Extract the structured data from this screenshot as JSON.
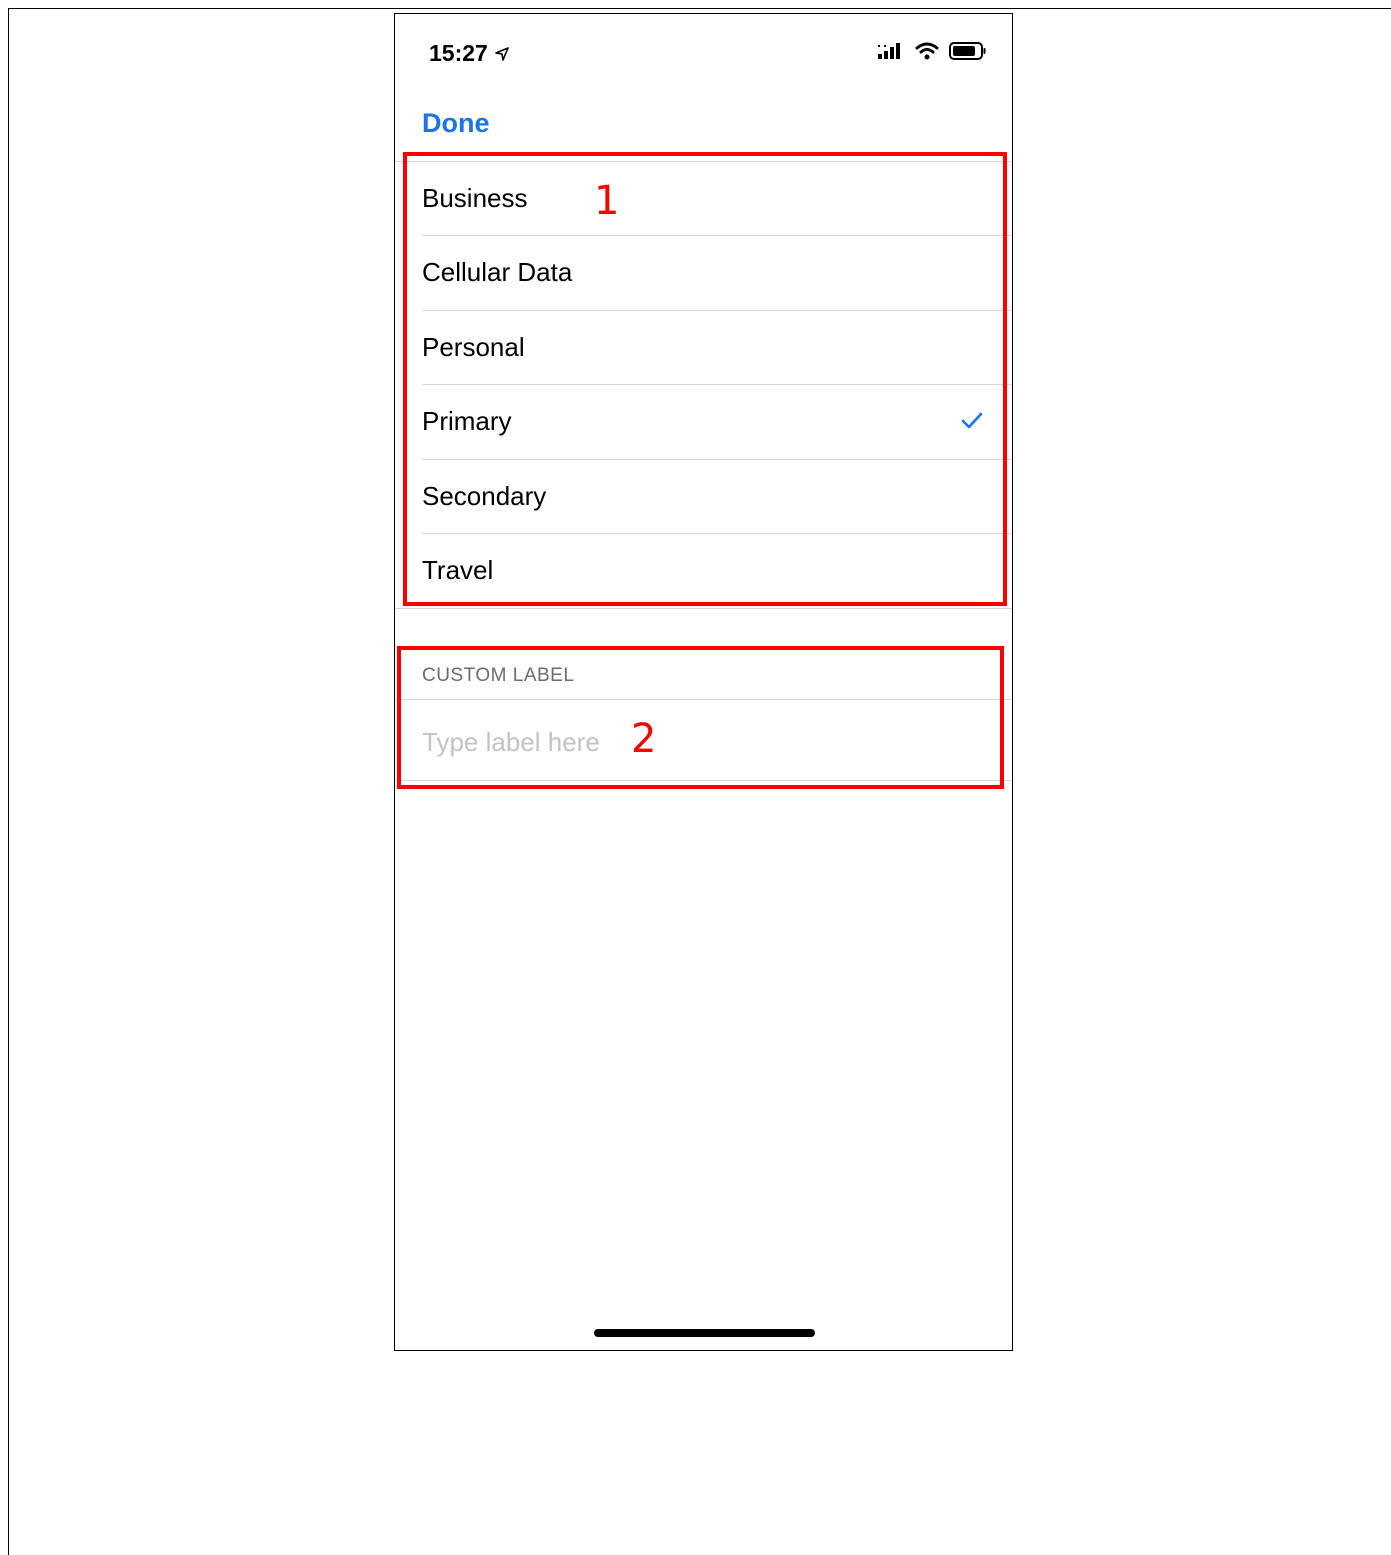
{
  "status_bar": {
    "time": "15:27",
    "location_icon": "location-arrow-icon",
    "signal_icon": "cellular-signal-icon",
    "wifi_icon": "wifi-icon",
    "battery_icon": "battery-icon"
  },
  "nav": {
    "done_label": "Done"
  },
  "labels": {
    "items": [
      {
        "label": "Business",
        "selected": false
      },
      {
        "label": "Cellular Data",
        "selected": false
      },
      {
        "label": "Personal",
        "selected": false
      },
      {
        "label": "Primary",
        "selected": true
      },
      {
        "label": "Secondary",
        "selected": false
      },
      {
        "label": "Travel",
        "selected": false
      }
    ],
    "check_icon": "checkmark-icon"
  },
  "custom_label": {
    "header": "CUSTOM LABEL",
    "placeholder": "Type label here",
    "value": ""
  },
  "annotations": {
    "box1_number": "1",
    "box2_number": "2",
    "color": "#ff0000"
  },
  "colors": {
    "accent": "#1a73e8",
    "placeholder": "#c3c3c7",
    "separator": "#d7d7d9"
  }
}
